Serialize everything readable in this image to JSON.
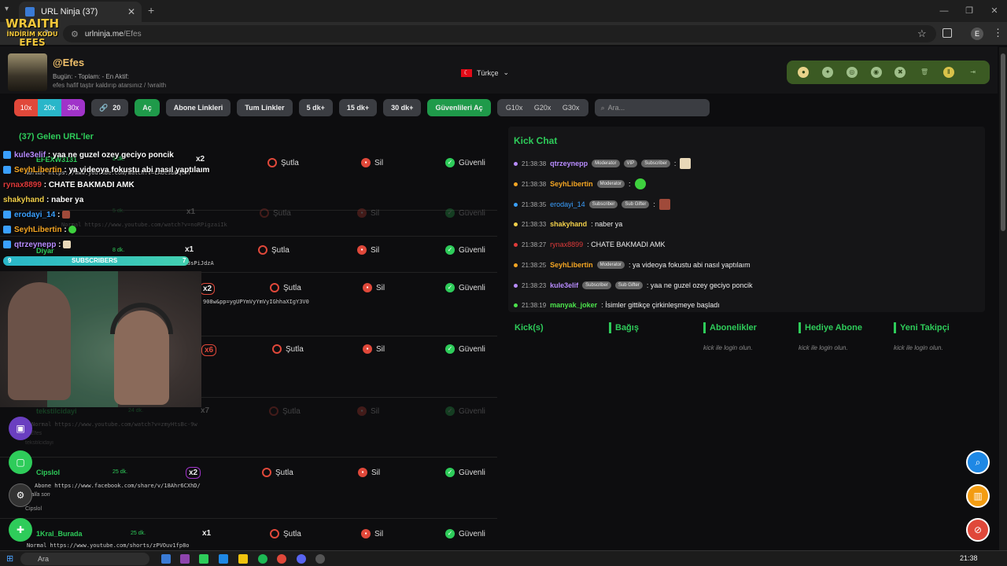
{
  "browser": {
    "tab_title": "URL Ninja (37)",
    "url_host": "urlninja.me",
    "url_path": "/Efes",
    "profile_initial": "E"
  },
  "logo": {
    "line1": "WRAITH",
    "line2": "İNDİRİM KODU",
    "line3": "EFES"
  },
  "header": {
    "username": "@Efes",
    "stats": "Bugün:  -   Toplam:  -   En Aktif:",
    "bio": "efes hafif taştır kaldırıp atarsınız / !wraith",
    "language": "Türkçe"
  },
  "toolbar": {
    "mult": [
      "10x",
      "20x",
      "30x"
    ],
    "count": "20",
    "ac": "Aç",
    "abone": "Abone Linkleri",
    "tum": "Tum Linkler",
    "d5": "5 dk+",
    "d15": "15 dk+",
    "d30": "30 dk+",
    "guvenli": "Güvenlileri Aç",
    "g": [
      "G10x",
      "G20x",
      "G30x"
    ],
    "search_placeholder": "Ara..."
  },
  "list": {
    "heading": "(37) Gelen URL'ler",
    "actions": {
      "sutla": "Şutla",
      "sil": "Sil",
      "guvenli": "Güvenli"
    },
    "rows": [
      {
        "name": "EFEXW3131",
        "time": "5 dk.",
        "mult": "x2",
        "link": "Normal https://www.youtube.com/watch?v=LAOcsbEqlWY"
      },
      {
        "name": "",
        "time": "5 dk.",
        "mult": "x1",
        "link": "Normal https://www.youtube.com/watch?v=noRPigzaiIk"
      },
      {
        "name": "Diyar",
        "time": "8 dk.",
        "mult": "x1",
        "link": "3sPiJdzA"
      },
      {
        "name": "",
        "time": "",
        "mult": "x2",
        "link": "908w&pp=ygUPYmVyYmVyIGhhaXIgY3V0"
      },
      {
        "name": "",
        "time": "",
        "mult": "x6",
        "link": ""
      },
      {
        "name": "tekstilcidayi",
        "time": "24 dk.",
        "mult": "x7",
        "link": "Normal https://www.youtube.com/watch?v=zmyHtsBc-9w",
        "note": "@Efes",
        "sub": "tekstilcidayi"
      },
      {
        "name": "Cipslol",
        "time": "25 dk.",
        "mult": "x2",
        "link": "Abone https://www.facebook.com/share/v/18Ahr6CXhD/",
        "note": "yalla son",
        "sub": "Cipslol"
      },
      {
        "name": "1Kral_Burada",
        "time": "25 dk.",
        "mult": "x1",
        "link": "Normal https://www.youtube.com/shorts/zPVOuv1fp8o"
      }
    ]
  },
  "overlay_chat": [
    {
      "user": "kule3elif",
      "text": ": yaa ne guzel ozey geciyo poncik",
      "color": "#b88cff"
    },
    {
      "user": "SeyhLibertin",
      "text": ": ya videoya fokustu abi nasıl yaptılaım",
      "color": "#f5a623"
    },
    {
      "user": "rynax8899",
      "text": ": CHATE BAKMADI AMK",
      "color": "#e03a3a"
    },
    {
      "user": "shakyhand",
      "text": ": naber ya",
      "color": "#f2d04a"
    },
    {
      "user": "erodayi_14",
      "text": ":",
      "color": "#3aa0ff"
    },
    {
      "user": "SeyhLibertin",
      "text": ":",
      "color": "#f5a623"
    },
    {
      "user": "qtrzeynepp",
      "text": ":",
      "color": "#b88cff"
    }
  ],
  "subbar": {
    "left": "9",
    "label": "SUBSCRIBERS",
    "right": "7"
  },
  "kick_chat": {
    "title": "Kick Chat",
    "messages": [
      {
        "time": "21:38:38",
        "user": "qtrzeynepp",
        "badges": [
          "Moderator",
          "VIP",
          "Subscriber"
        ],
        "text": ":",
        "dot": "#b88cff",
        "ucolor": "#b88cff"
      },
      {
        "time": "21:38:38",
        "user": "SeyhLibertin",
        "badges": [
          "Moderator"
        ],
        "text": ":",
        "dot": "#f5a623",
        "ucolor": "#f5a623"
      },
      {
        "time": "21:38:35",
        "user": "erodayi_14",
        "badges": [
          "Subscriber",
          "Sub Gifter"
        ],
        "text": ":",
        "dot": "#3aa0ff",
        "ucolor": "#3aa0ff"
      },
      {
        "time": "21:38:33",
        "user": "shakyhand",
        "badges": [],
        "text": ": naber ya",
        "dot": "#f2d04a",
        "ucolor": "#f2d04a"
      },
      {
        "time": "21:38:27",
        "user": "rynax8899",
        "badges": [],
        "text": ": CHATE BAKMADI AMK",
        "dot": "#e03a3a",
        "ucolor": "#e03a3a"
      },
      {
        "time": "21:38:25",
        "user": "SeyhLibertin",
        "badges": [
          "Moderator"
        ],
        "text": ": ya videoya fokustu abi nasıl yaptılaım",
        "dot": "#f5a623",
        "ucolor": "#f5a623"
      },
      {
        "time": "21:38:23",
        "user": "kule3elif",
        "badges": [
          "Subscriber",
          "Sub Gifter"
        ],
        "text": ": yaa ne guzel ozey geciyo poncik",
        "dot": "#b88cff",
        "ucolor": "#b88cff"
      },
      {
        "time": "21:38:19",
        "user": "manyak_joker",
        "badges": [],
        "text": ": İsimler gittikçe çirkinleşmeye başladı",
        "dot": "#4ce34c",
        "ucolor": "#4ce34c"
      }
    ]
  },
  "panels": [
    {
      "title": "Kick(s)",
      "note": ""
    },
    {
      "title": "Bağış",
      "note": ""
    },
    {
      "title": "Abonelikler",
      "note": "kick ile login olun."
    },
    {
      "title": "Hediye Abone",
      "note": "kick ile login olun."
    },
    {
      "title": "Yeni Takipçi",
      "note": "kick ile login olun."
    }
  ],
  "taskbar": {
    "search": "Ara",
    "clock": "21:38"
  },
  "colors": {
    "accent_green": "#2ecc5a",
    "red": "#e0483a",
    "cyan": "#29b6c9",
    "purple": "#a033c9"
  }
}
